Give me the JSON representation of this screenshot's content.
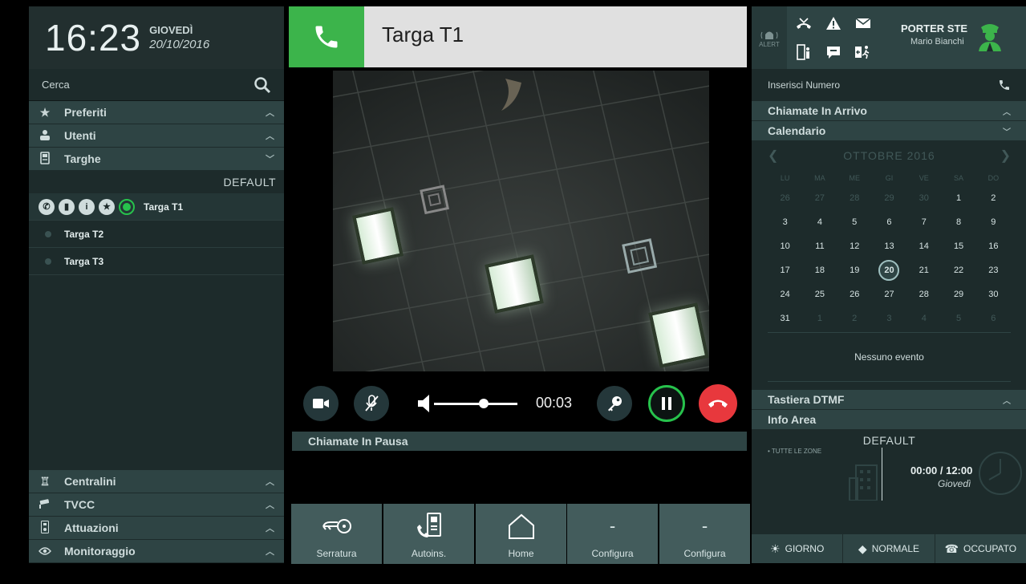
{
  "clock": {
    "time": "16:23",
    "day": "GIOVEDÌ",
    "date": "20/10/2016"
  },
  "search": {
    "placeholder": "Cerca"
  },
  "left_sections": [
    {
      "label": "Preferiti",
      "icon": "star-icon"
    },
    {
      "label": "Utenti",
      "icon": "user-icon"
    },
    {
      "label": "Targhe",
      "icon": "intercom-icon"
    }
  ],
  "targhe": {
    "group": "DEFAULT",
    "items": [
      {
        "label": "Targa T1",
        "active": true
      },
      {
        "label": "Targa T2",
        "active": false
      },
      {
        "label": "Targa T3",
        "active": false
      }
    ],
    "active_actions": [
      "call-icon",
      "door-icon",
      "info-icon",
      "favorite-icon",
      "status-icon"
    ]
  },
  "left_bottom_sections": [
    {
      "label": "Centralini",
      "icon": "switchboard-icon"
    },
    {
      "label": "TVCC",
      "icon": "cctv-icon"
    },
    {
      "label": "Attuazioni",
      "icon": "actuator-icon"
    },
    {
      "label": "Monitoraggio",
      "icon": "eye-icon"
    }
  ],
  "call": {
    "title": "Targa T1",
    "timer": "00:03",
    "volume_level": 0.6
  },
  "call_controls": [
    "video-icon",
    "mute-mic-icon",
    "volume-icon",
    "key-icon",
    "pause-icon",
    "hangup-icon"
  ],
  "paused_calls": {
    "label": "Chiamate In Pausa"
  },
  "bottom_buttons": [
    {
      "label": "Serratura",
      "icon": "lock-key-icon",
      "glyph": ""
    },
    {
      "label": "Autoins.",
      "icon": "autoinsert-icon",
      "glyph": ""
    },
    {
      "label": "Home",
      "icon": "home-icon",
      "glyph": ""
    },
    {
      "label": "Configura",
      "icon": "dash-icon",
      "glyph": "-"
    },
    {
      "label": "Configura",
      "icon": "dash-icon",
      "glyph": "-"
    }
  ],
  "status": {
    "alert_label": "ALERT",
    "porter_name": "PORTER STE",
    "user_name": "Mario Bianchi"
  },
  "dial": {
    "placeholder": "Inserisci Numero"
  },
  "right_sections": {
    "incoming": "Chiamate In Arrivo",
    "calendar": "Calendario",
    "dtmf": "Tastiera DTMF",
    "info": "Info Area"
  },
  "calendar": {
    "month": "OTTOBRE",
    "year": "2016",
    "weekdays": [
      "LU",
      "MA",
      "ME",
      "GI",
      "VE",
      "SA",
      "DO"
    ],
    "days": [
      [
        "26",
        "27",
        "28",
        "29",
        "30",
        "1",
        "2"
      ],
      [
        "3",
        "4",
        "5",
        "6",
        "7",
        "8",
        "9"
      ],
      [
        "10",
        "11",
        "12",
        "13",
        "14",
        "15",
        "16"
      ],
      [
        "17",
        "18",
        "19",
        "20",
        "21",
        "22",
        "23"
      ],
      [
        "24",
        "25",
        "26",
        "27",
        "28",
        "29",
        "30"
      ],
      [
        "31",
        "1",
        "2",
        "3",
        "4",
        "5",
        "6"
      ]
    ],
    "today": "20",
    "no_event": "Nessuno evento"
  },
  "info_area": {
    "group": "DEFAULT",
    "zones": "• TUTTE LE ZONE",
    "hours": "00:00 / 12:00",
    "day": "Giovedì"
  },
  "modes": [
    {
      "label": "GIORNO",
      "glyph": "☀",
      "icon": "sun-icon"
    },
    {
      "label": "NORMALE",
      "glyph": "◆",
      "icon": "diamond-icon"
    },
    {
      "label": "OCCUPATO",
      "glyph": "☎",
      "icon": "phone-hook-icon"
    }
  ],
  "colors": {
    "accent_green": "#3cb44b",
    "hangup_red": "#e8383d",
    "panel": "#1d2b2b",
    "header_bar": "#2e4444"
  }
}
